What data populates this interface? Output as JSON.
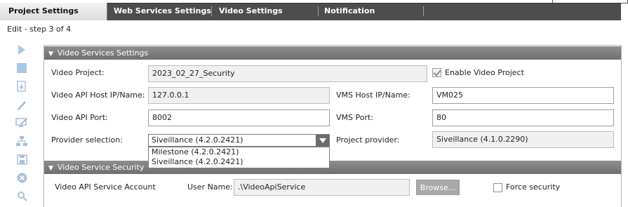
{
  "tabs": [
    {
      "label": "Project Settings",
      "active": true
    },
    {
      "label": "Web Services Settings",
      "active": false
    },
    {
      "label": "Video Settings",
      "active": false
    },
    {
      "label": "Notification",
      "active": false
    }
  ],
  "step_text": "Edit - step 3 of 4",
  "toolbar": {
    "icons": [
      "play-icon",
      "stop-icon",
      "import-icon",
      "edit-icon",
      "monitor-edit-icon",
      "network-icon",
      "save-icon",
      "cancel-icon",
      "settings-icon"
    ]
  },
  "video_services": {
    "title": "Video Services Settings",
    "video_project_label": "Video Project:",
    "video_project_value": "2023_02_27_Security",
    "enable_label": "Enable Video Project",
    "enable_checked": true,
    "api_host_label": "Video API Host IP/Name:",
    "api_host_value": "127.0.0.1",
    "vms_host_label": "VMS Host IP/Name:",
    "vms_host_value": "VM025",
    "api_port_label": "Video API Port:",
    "api_port_value": "8002",
    "vms_port_label": "VMS Port:",
    "vms_port_value": "80",
    "provider_label": "Provider selection:",
    "provider_value": "Siveillance (4.2.0.2421)",
    "provider_options": [
      "Milestone (4.2.0.2421)",
      "Siveillance (4.2.0.2421)"
    ],
    "project_provider_label": "Project provider:",
    "project_provider_value": "Siveillance (4.1.0.2290)"
  },
  "security": {
    "title": "Video Service Security",
    "account_label": "Video API Service Account",
    "username_label": "User Name:",
    "username_value": ".\\VideoApiService",
    "browse_label": "Browse...",
    "force_label": "Force security",
    "force_checked": false
  }
}
